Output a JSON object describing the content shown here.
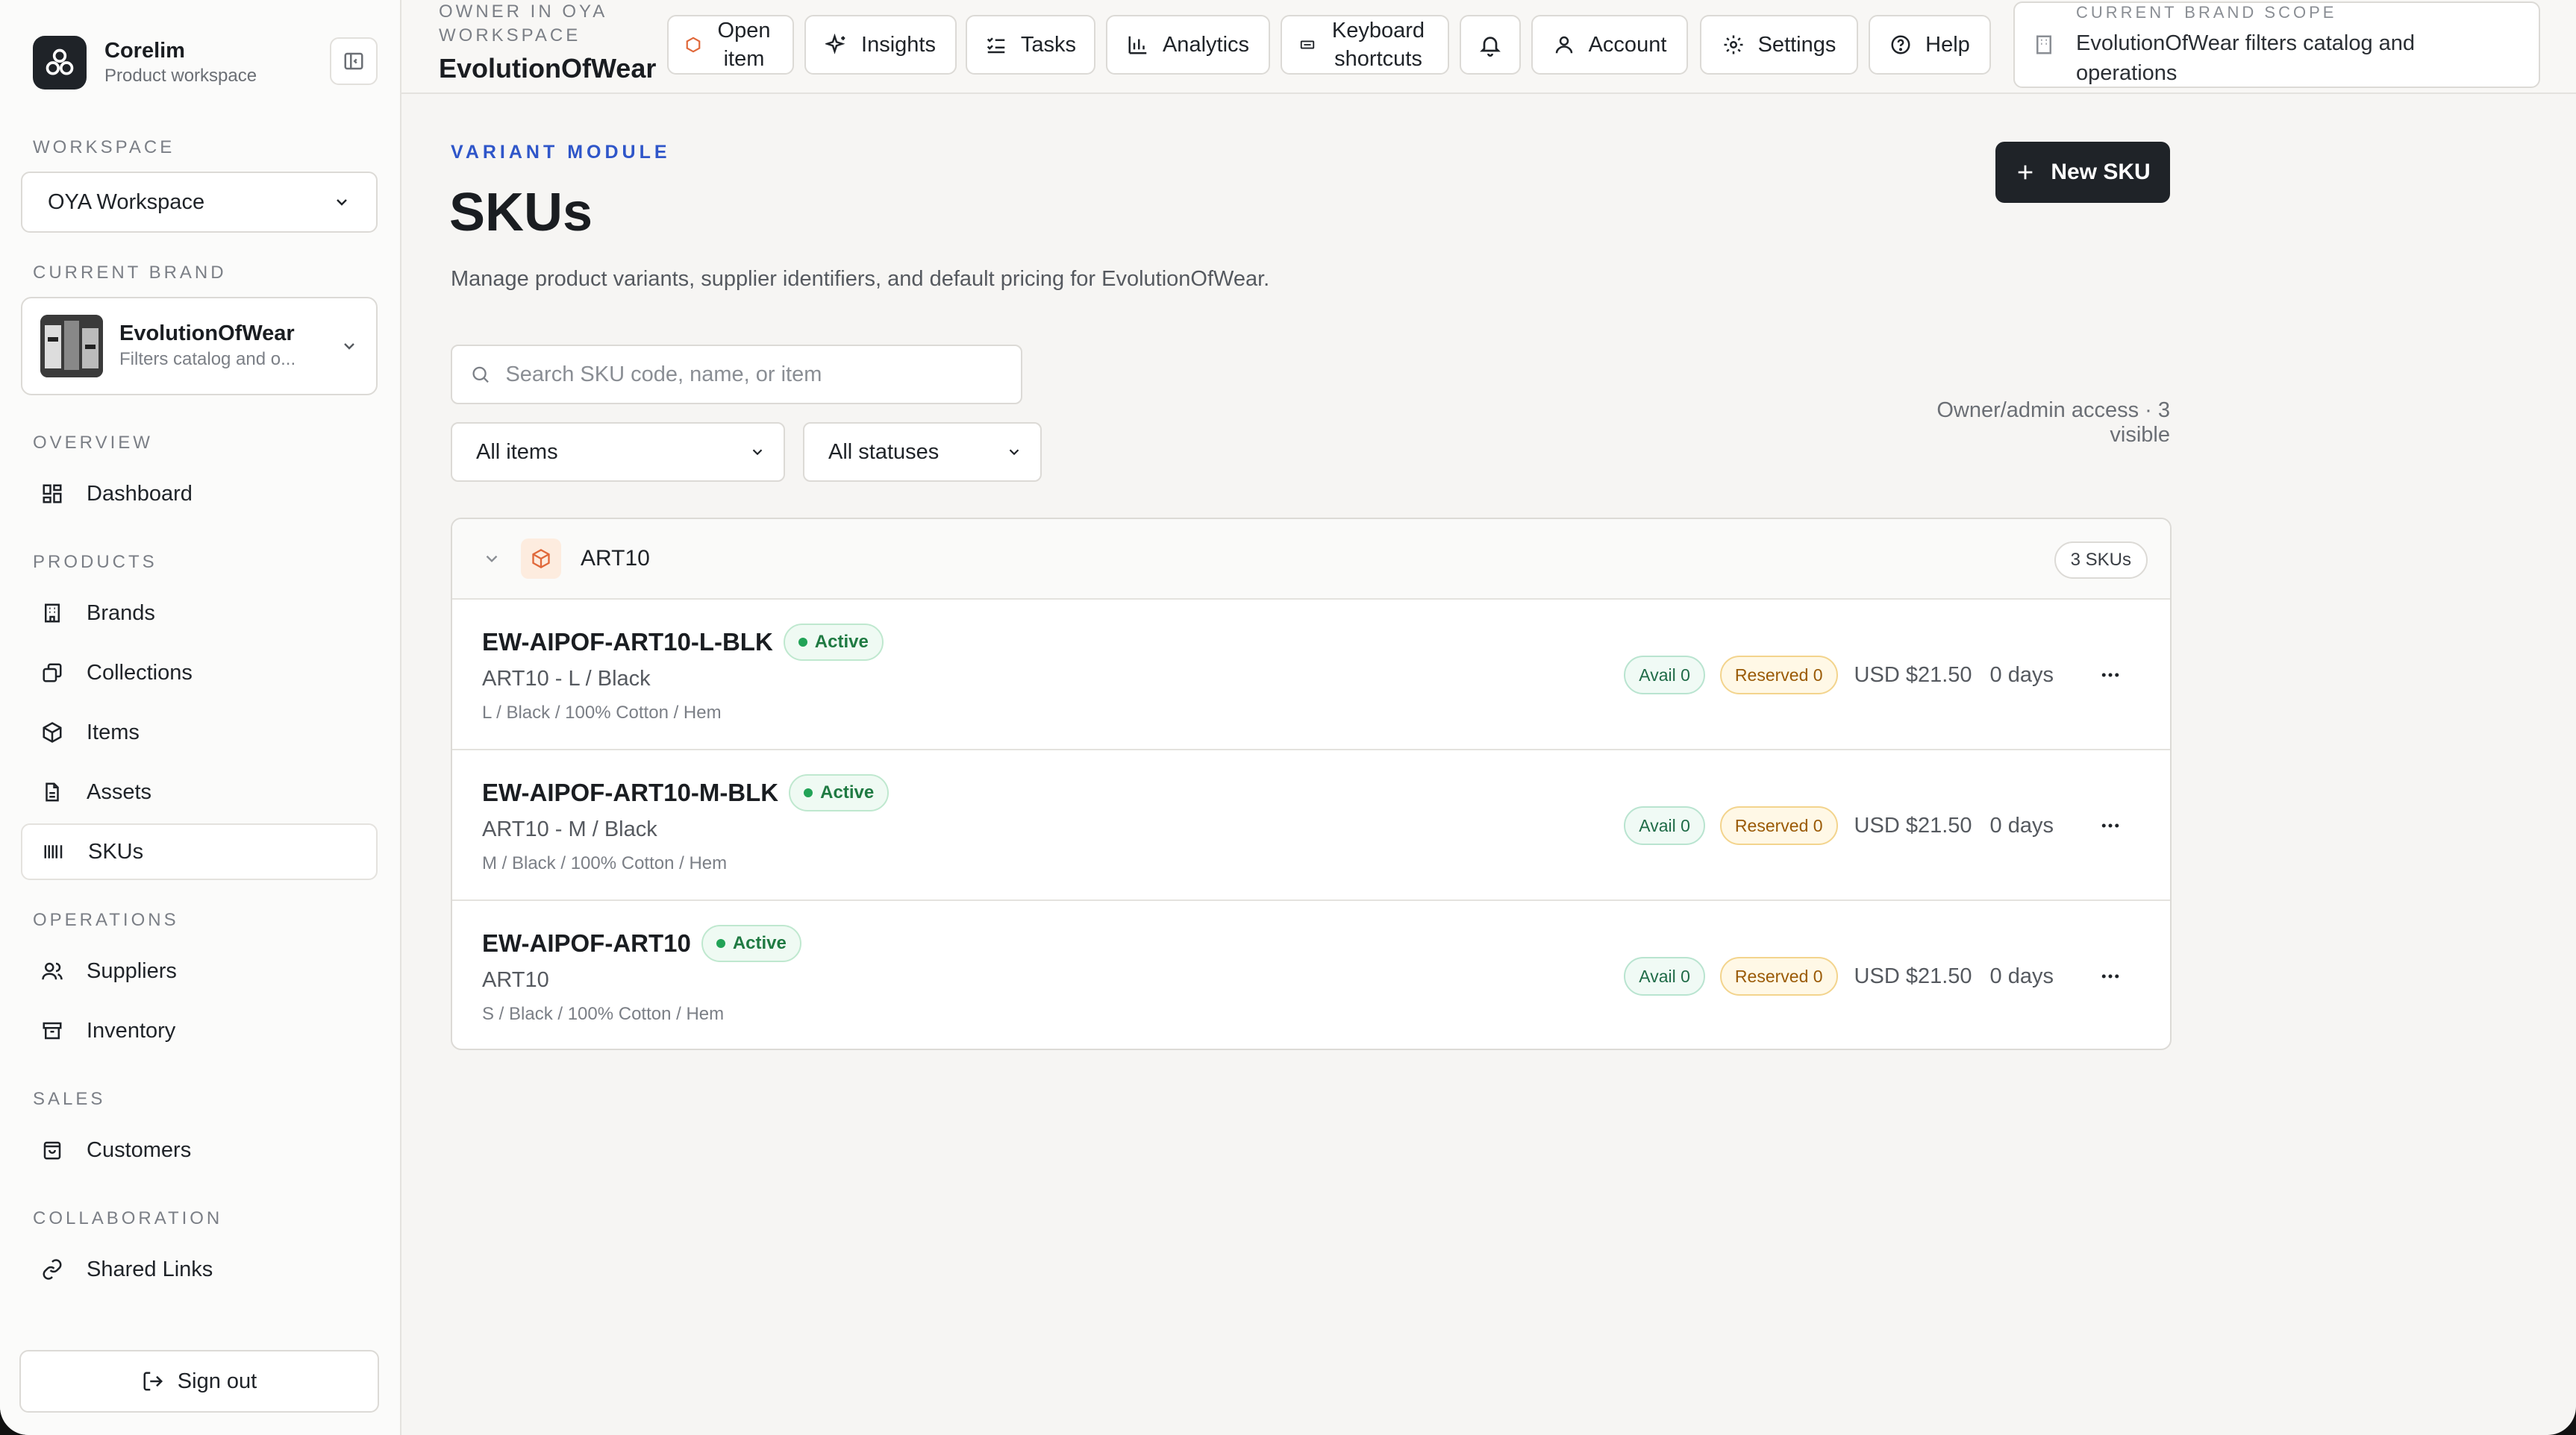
{
  "app": {
    "name": "Corelim",
    "subtitle": "Product workspace"
  },
  "sidebar": {
    "workspace_label": "WORKSPACE",
    "workspace_value": "OYA Workspace",
    "brand_label": "CURRENT BRAND",
    "brand_name": "EvolutionOfWear",
    "brand_sub": "Filters catalog and o...",
    "sections": [
      {
        "label": "OVERVIEW",
        "items": [
          {
            "label": "Dashboard",
            "icon": "dashboard-icon"
          }
        ]
      },
      {
        "label": "PRODUCTS",
        "items": [
          {
            "label": "Brands",
            "icon": "building-icon"
          },
          {
            "label": "Collections",
            "icon": "layers-icon"
          },
          {
            "label": "Items",
            "icon": "box-icon"
          },
          {
            "label": "Assets",
            "icon": "file-icon"
          },
          {
            "label": "SKUs",
            "icon": "barcode-icon",
            "active": true
          }
        ]
      },
      {
        "label": "OPERATIONS",
        "items": [
          {
            "label": "Suppliers",
            "icon": "users-icon"
          },
          {
            "label": "Inventory",
            "icon": "archive-icon"
          }
        ]
      },
      {
        "label": "SALES",
        "items": [
          {
            "label": "Customers",
            "icon": "shopping-bag-icon"
          }
        ]
      },
      {
        "label": "COLLABORATION",
        "items": [
          {
            "label": "Shared Links",
            "icon": "link-icon"
          }
        ]
      }
    ],
    "signout": "Sign out"
  },
  "topbar": {
    "owner_label": "OWNER IN OYA WORKSPACE",
    "owner_brand": "EvolutionOfWear",
    "open_item": "Open item",
    "insights": "Insights",
    "tasks": "Tasks",
    "analytics": "Analytics",
    "shortcuts": "Keyboard shortcuts",
    "account": "Account",
    "settings": "Settings",
    "help": "Help",
    "scope_label": "CURRENT BRAND SCOPE",
    "scope_value": "EvolutionOfWear filters catalog and operations"
  },
  "page": {
    "eyebrow": "VARIANT MODULE",
    "title": "SKUs",
    "description": "Manage product variants, supplier identifiers, and default pricing for EvolutionOfWear.",
    "new_button": "New SKU",
    "search_placeholder": "Search SKU code, name, or item",
    "filter_items": "All items",
    "filter_status": "All statuses",
    "access_text": "Owner/admin access · 3 visible"
  },
  "group": {
    "name": "ART10",
    "count": "3 SKUs",
    "rows": [
      {
        "code": "EW-AIPOF-ART10-L-BLK",
        "status": "Active",
        "name": "ART10 - L / Black",
        "attrs": "L / Black / 100% Cotton / Hem",
        "avail": "Avail 0",
        "reserved": "Reserved 0",
        "price": "USD $21.50",
        "days": "0 days"
      },
      {
        "code": "EW-AIPOF-ART10-M-BLK",
        "status": "Active",
        "name": "ART10 - M / Black",
        "attrs": "M / Black / 100% Cotton / Hem",
        "avail": "Avail 0",
        "reserved": "Reserved 0",
        "price": "USD $21.50",
        "days": "0 days"
      },
      {
        "code": "EW-AIPOF-ART10",
        "status": "Active",
        "name": "ART10",
        "attrs": "S / Black / 100% Cotton / Hem",
        "avail": "Avail 0",
        "reserved": "Reserved 0",
        "price": "USD $21.50",
        "days": "0 days"
      }
    ]
  },
  "colors": {
    "accent": "#2f56c9",
    "primary_button": "#1f2328",
    "active_green": "#22a357",
    "reserved_amber": "#9a5a06"
  }
}
